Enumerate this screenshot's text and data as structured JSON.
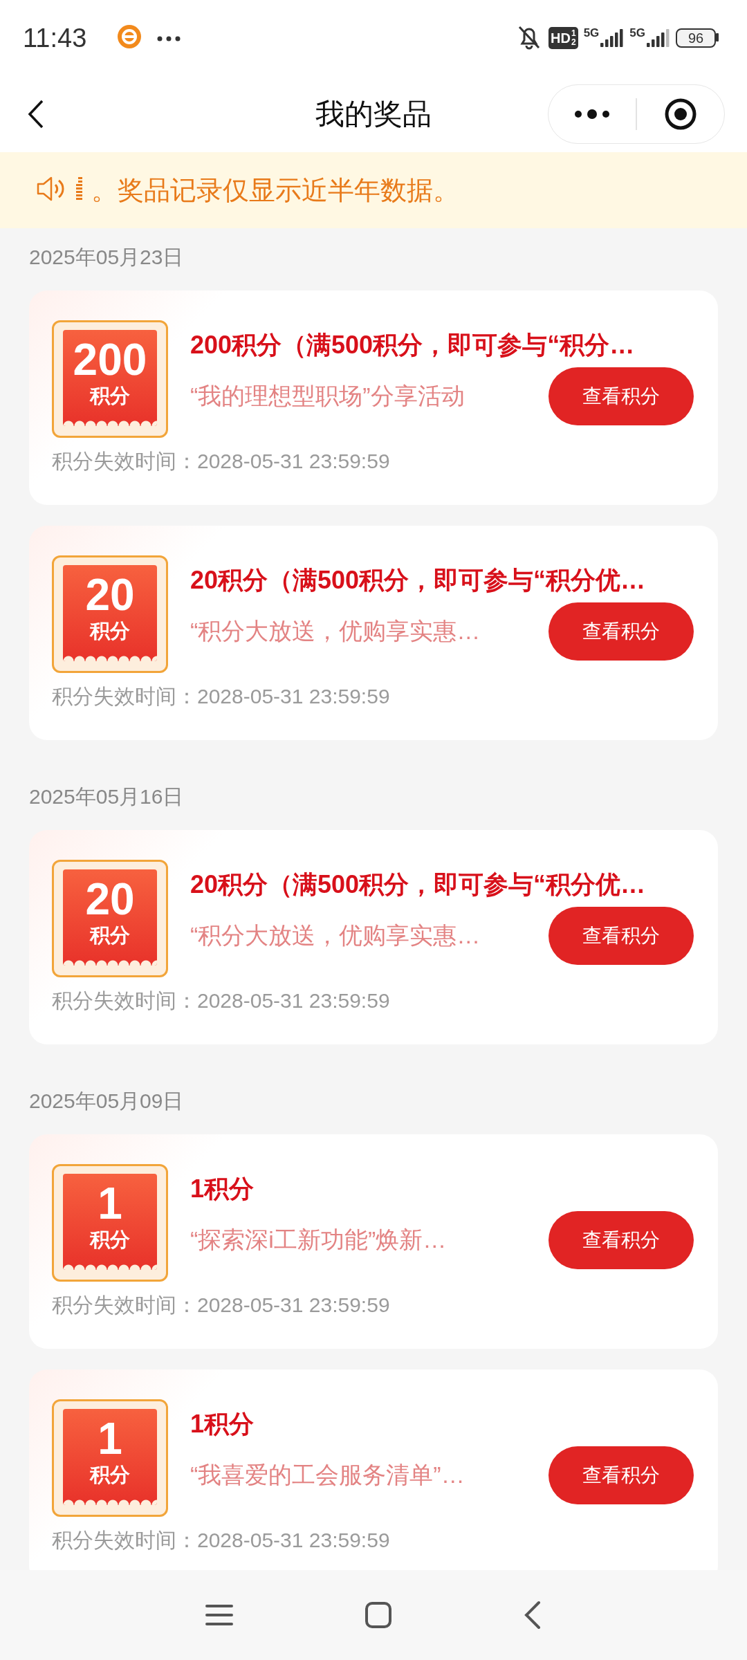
{
  "status_bar": {
    "time": "11:43",
    "network": [
      "5G",
      "5G"
    ],
    "hd": {
      "label": "HD",
      "sims": [
        "1",
        "2"
      ]
    },
    "battery": "96"
  },
  "title_bar": {
    "title": "我的奖品"
  },
  "notice": {
    "text": "。奖品记录仅显示近半年数据。"
  },
  "groups": [
    {
      "date": "2025年05月23日",
      "prizes": [
        {
          "amount": "200",
          "unit": "积分",
          "title": "200积分（满500积分，即可参与“积分…",
          "source": "“我的理想型职场”分享活动",
          "button": "查看积分",
          "expiry": "积分失效时间：2028-05-31 23:59:59"
        },
        {
          "amount": "20",
          "unit": "积分",
          "title": "20积分（满500积分，即可参与“积分优…",
          "source": "“积分大放送，优购享实惠…",
          "button": "查看积分",
          "expiry": "积分失效时间：2028-05-31 23:59:59"
        }
      ]
    },
    {
      "date": "2025年05月16日",
      "prizes": [
        {
          "amount": "20",
          "unit": "积分",
          "title": "20积分（满500积分，即可参与“积分优…",
          "source": "“积分大放送，优购享实惠…",
          "button": "查看积分",
          "expiry": "积分失效时间：2028-05-31 23:59:59"
        }
      ]
    },
    {
      "date": "2025年05月09日",
      "prizes": [
        {
          "amount": "1",
          "unit": "积分",
          "title": "1积分",
          "source": "“探索深i工新功能”焕新…",
          "button": "查看积分",
          "expiry": "积分失效时间：2028-05-31 23:59:59"
        },
        {
          "amount": "1",
          "unit": "积分",
          "title": "1积分",
          "source": "“我喜爱的工会服务清单”…",
          "button": "查看积分",
          "expiry": "积分失效时间：2028-05-31 23:59:59"
        }
      ]
    }
  ]
}
